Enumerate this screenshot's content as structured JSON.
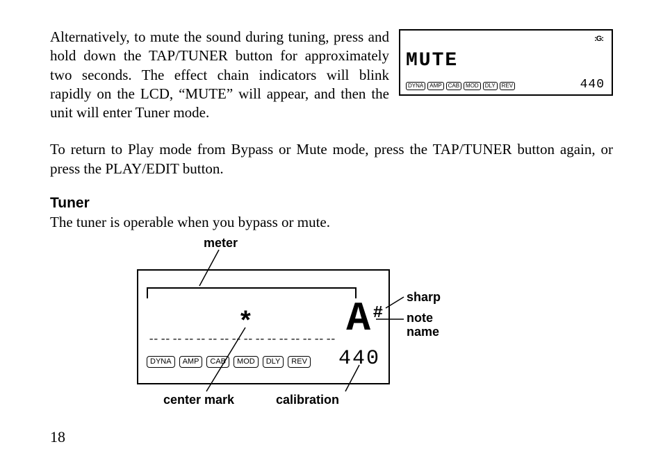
{
  "para1": "Alternatively, to mute the sound during tuning, press and hold down the TAP/TUNER button for approximately two seconds. The effect chain indicators will blink rapidly on the LCD, “MUTE” will appear, and then the unit will enter Tuner mode.",
  "para2": "To return to Play mode from Bypass or Mute mode, press the TAP/TUNER button again, or press the PLAY/EDIT button.",
  "heading_tuner": "Tuner",
  "para3": "The tuner is operable when you bypass or mute.",
  "mute_lcd": {
    "g_icon": ":G:",
    "mute_text": "MUTE",
    "chips": [
      "DYNA",
      "AMP",
      "CAB",
      "MOD",
      "DLY",
      "REV"
    ],
    "cal": "440"
  },
  "big_lcd": {
    "segments": [
      "--",
      "--",
      "--",
      "--",
      "--",
      "--",
      "--",
      "--",
      "--",
      "--",
      "--",
      "--",
      "--",
      "--",
      "--",
      "--"
    ],
    "center_mark": "*",
    "note_name": "A",
    "sharp": "#",
    "cal": "440",
    "chips": [
      "DYNA",
      "AMP",
      "CAB",
      "MOD",
      "DLY",
      "REV"
    ]
  },
  "labels": {
    "meter": "meter",
    "sharp": "sharp",
    "note_name_l1": "note",
    "note_name_l2": "name",
    "center_mark": "center mark",
    "calibration": "calibration"
  },
  "page_number": "18"
}
